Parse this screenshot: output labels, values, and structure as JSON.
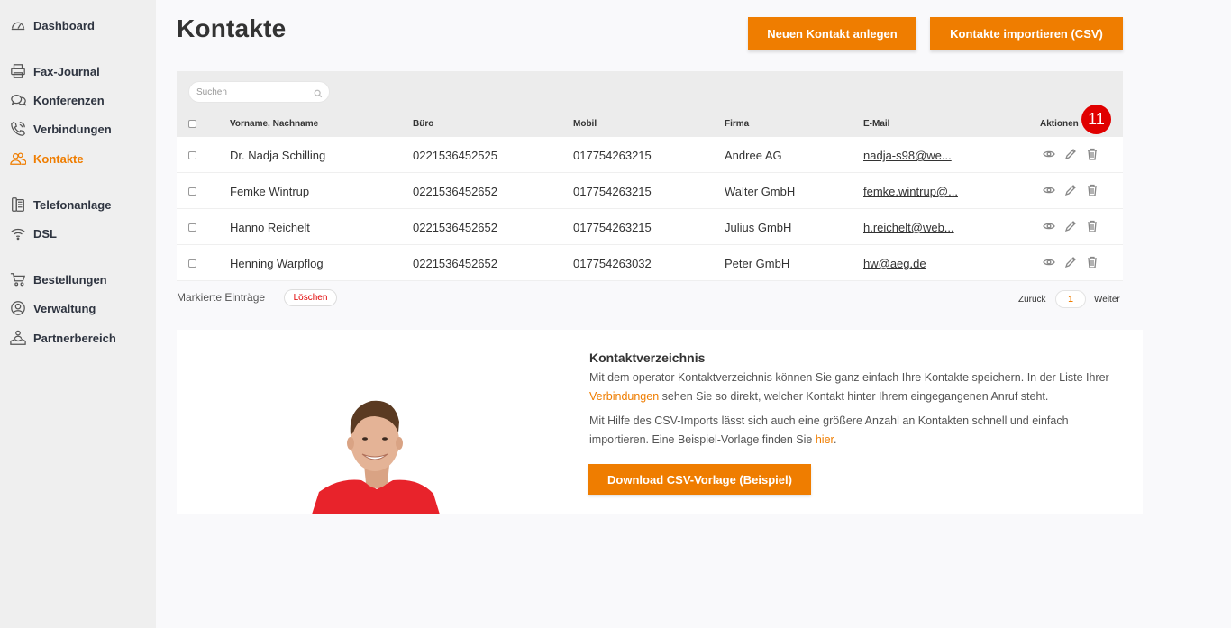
{
  "sidebar": {
    "items": [
      {
        "label": "Dashboard",
        "icon": "gauge-icon",
        "active": false
      },
      {
        "label": "Fax-Journal",
        "icon": "printer-icon",
        "active": false
      },
      {
        "label": "Konferenzen",
        "icon": "chat-bubbles-icon",
        "active": false
      },
      {
        "label": "Verbindungen",
        "icon": "phone-icon",
        "active": false
      },
      {
        "label": "Kontakte",
        "icon": "users-icon",
        "active": true
      },
      {
        "label": "Telefonanlage",
        "icon": "phone-system-icon",
        "active": false
      },
      {
        "label": "DSL",
        "icon": "wifi-icon",
        "active": false
      },
      {
        "label": "Bestellungen",
        "icon": "cart-icon",
        "active": false
      },
      {
        "label": "Verwaltung",
        "icon": "user-circle-icon",
        "active": false
      },
      {
        "label": "Partnerbereich",
        "icon": "partner-icon",
        "active": false
      }
    ]
  },
  "header": {
    "title": "Kontakte",
    "new_button": "Neuen Kontakt anlegen",
    "import_button": "Kontakte importieren (CSV)"
  },
  "table": {
    "search_placeholder": "Suchen",
    "columns": [
      "Vorname, Nachname",
      "Büro",
      "Mobil",
      "Firma",
      "E-Mail",
      "Aktionen"
    ],
    "rows": [
      {
        "name": "Dr. Nadja Schilling",
        "office": "0221536452525",
        "mobile": "017754263215",
        "company": "Andree AG",
        "email": "nadja-s98@we..."
      },
      {
        "name": "Femke Wintrup",
        "office": "0221536452652",
        "mobile": "017754263215",
        "company": "Walter GmbH",
        "email": "femke.wintrup@..."
      },
      {
        "name": "Hanno Reichelt",
        "office": "0221536452652",
        "mobile": "017754263215",
        "company": "Julius GmbH",
        "email": "h.reichelt@web..."
      },
      {
        "name": "Henning Warpflog",
        "office": "0221536452652",
        "mobile": "017754263032",
        "company": "Peter GmbH",
        "email": "hw@aeg.de"
      }
    ],
    "badge": "11"
  },
  "footer": {
    "marked_label": "Markierte Einträge",
    "delete_button": "Löschen",
    "back_label": "Zurück",
    "page": "1",
    "next_label": "Weiter"
  },
  "info": {
    "title": "Kontaktverzeichnis",
    "p1_a": "Mit dem operator Kontaktverzeichnis können Sie ganz einfach Ihre Kontakte speichern. In der Liste Ihrer ",
    "p1_link": "Verbindungen",
    "p1_b": " sehen Sie so direkt, welcher Kontakt hinter Ihrem eingegangenen Anruf steht.",
    "p2_a": "Mit Hilfe des CSV-Imports lässt sich auch eine größere Anzahl an Kontakten schnell und einfach importieren. Eine Beispiel-Vorlage finden Sie ",
    "p2_link": "hier",
    "p2_b": ".",
    "download_button": "Download CSV-Vorlage (Beispiel)"
  },
  "colors": {
    "accent": "#ef7d00",
    "badge": "#e00000",
    "delete": "#e00000"
  }
}
